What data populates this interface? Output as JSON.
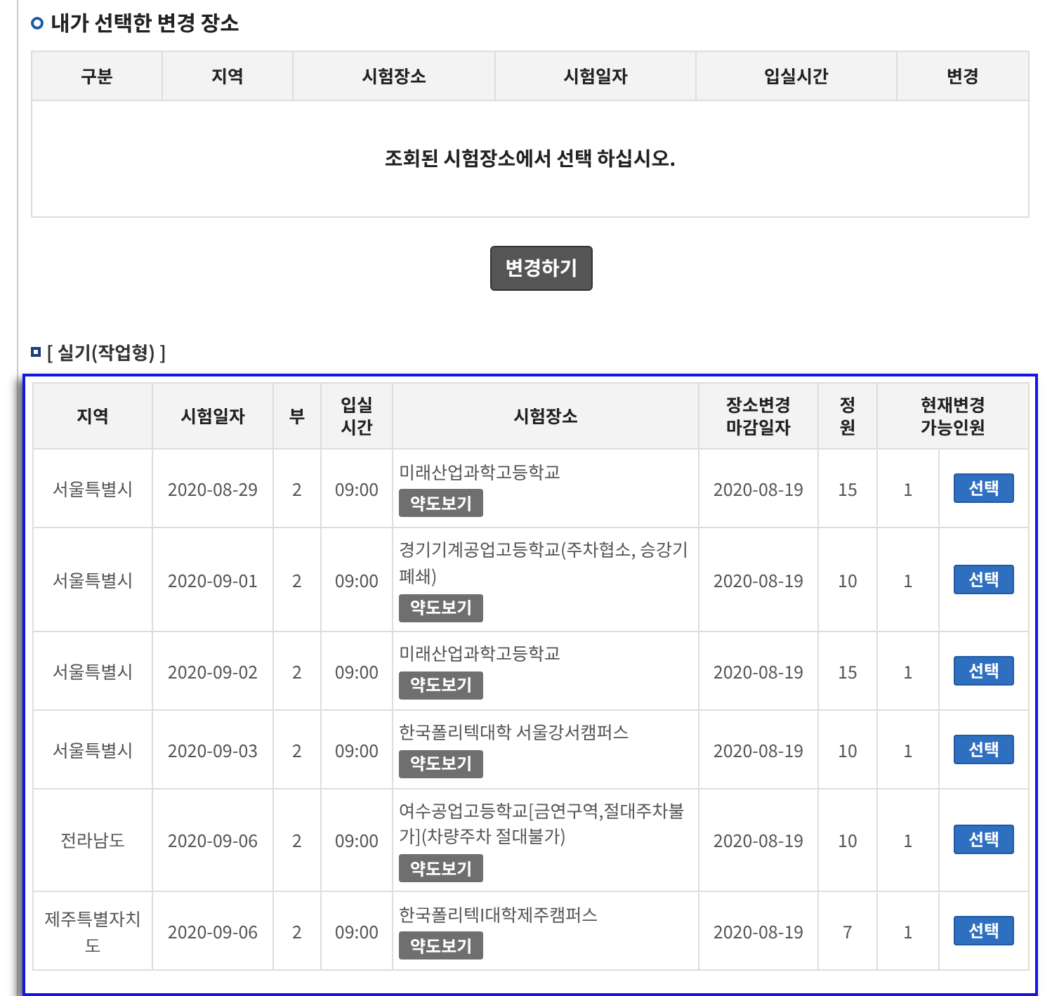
{
  "selected_section": {
    "title": "내가 선택한 변경 장소",
    "columns": [
      "구분",
      "지역",
      "시험장소",
      "시험일자",
      "입실시간",
      "변경"
    ],
    "empty_message": "조회된 시험장소에서 선택 하십시오.",
    "submit_button": "변경하기"
  },
  "practical_section": {
    "title": "[ 실기(작업형) ]",
    "columns": [
      "지역",
      "시험일자",
      "부",
      "입실\n시간",
      "시험장소",
      "장소변경\n마감일자",
      "정\n원",
      "현재변경\n가능인원"
    ],
    "rows": [
      {
        "region": "서울특별시",
        "exam_date": "2020-08-29",
        "session": "2",
        "entry_time": "09:00",
        "venue": "미래산업과학고등학교",
        "map_button": "약도보기",
        "deadline": "2020-08-19",
        "capacity": "15",
        "available": "1",
        "select_button": "선택"
      },
      {
        "region": "서울특별시",
        "exam_date": "2020-09-01",
        "session": "2",
        "entry_time": "09:00",
        "venue": "경기기계공업고등학교(주차협소, 승강기 폐쇄)",
        "map_button": "약도보기",
        "deadline": "2020-08-19",
        "capacity": "10",
        "available": "1",
        "select_button": "선택"
      },
      {
        "region": "서울특별시",
        "exam_date": "2020-09-02",
        "session": "2",
        "entry_time": "09:00",
        "venue": "미래산업과학고등학교",
        "map_button": "약도보기",
        "deadline": "2020-08-19",
        "capacity": "15",
        "available": "1",
        "select_button": "선택"
      },
      {
        "region": "서울특별시",
        "exam_date": "2020-09-03",
        "session": "2",
        "entry_time": "09:00",
        "venue": "한국폴리텍대학 서울강서캠퍼스",
        "map_button": "약도보기",
        "deadline": "2020-08-19",
        "capacity": "10",
        "available": "1",
        "select_button": "선택"
      },
      {
        "region": "전라남도",
        "exam_date": "2020-09-06",
        "session": "2",
        "entry_time": "09:00",
        "venue": "여수공업고등학교[금연구역,절대주차불가](차량주차 절대불가)",
        "map_button": "약도보기",
        "deadline": "2020-08-19",
        "capacity": "10",
        "available": "1",
        "select_button": "선택"
      },
      {
        "region": "제주특별자치도",
        "exam_date": "2020-09-06",
        "session": "2",
        "entry_time": "09:00",
        "venue": "한국폴리텍I대학제주캠퍼스",
        "map_button": "약도보기",
        "deadline": "2020-08-19",
        "capacity": "7",
        "available": "1",
        "select_button": "선택"
      }
    ]
  }
}
